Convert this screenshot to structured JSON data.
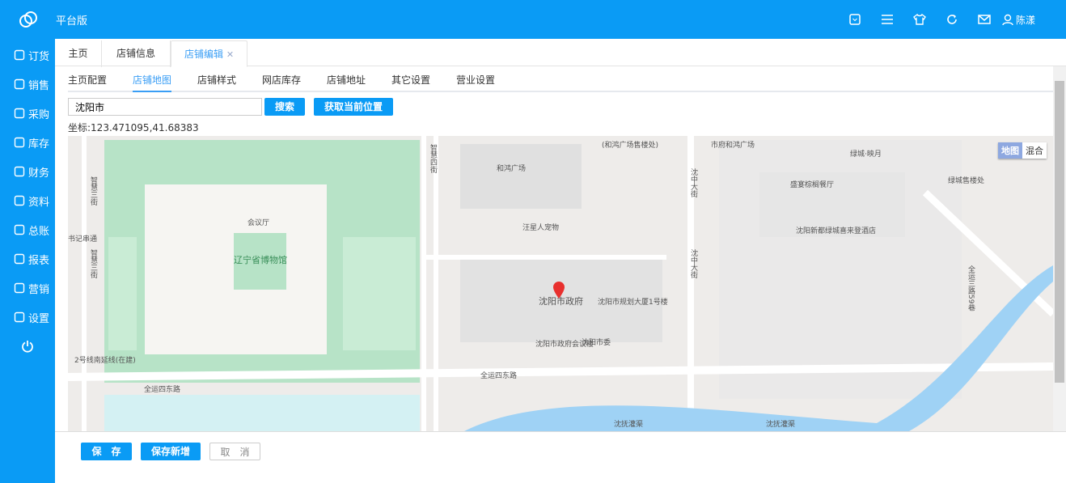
{
  "header": {
    "brand": "平台版",
    "user": "陈漾",
    "icons": [
      "dropdown-box-icon",
      "menu-icon",
      "shirt-icon",
      "refresh-icon",
      "mail-icon",
      "user-icon"
    ]
  },
  "sidebar": {
    "items": [
      {
        "label": "订货",
        "icon": "clipboard-icon"
      },
      {
        "label": "销售",
        "icon": "user-icon"
      },
      {
        "label": "采购",
        "icon": "cart-icon"
      },
      {
        "label": "库存",
        "icon": "box-icon"
      },
      {
        "label": "财务",
        "icon": "wallet-icon"
      },
      {
        "label": "资料",
        "icon": "contacts-icon"
      },
      {
        "label": "总账",
        "icon": "chart-icon"
      },
      {
        "label": "报表",
        "icon": "report-icon"
      },
      {
        "label": "营销",
        "icon": "monitor-icon"
      },
      {
        "label": "设置",
        "icon": "gear-icon"
      }
    ]
  },
  "tabs": [
    {
      "label": "主页"
    },
    {
      "label": "店铺信息"
    },
    {
      "label": "店铺编辑",
      "active": true
    }
  ],
  "subtabs": [
    {
      "label": "主页配置"
    },
    {
      "label": "店铺地图",
      "active": true
    },
    {
      "label": "店铺样式"
    },
    {
      "label": "网店库存"
    },
    {
      "label": "店铺地址"
    },
    {
      "label": "其它设置"
    },
    {
      "label": "营业设置"
    }
  ],
  "search": {
    "value": "沈阳市",
    "button": "搜索",
    "locate_button": "获取当前位置"
  },
  "coordinate": "坐标:123.471095,41.68383",
  "map": {
    "type_toggle": [
      "地图",
      "混合"
    ],
    "labels": [
      "辽宁省博物馆",
      "会议厅",
      "和鸿广场",
      "汪星人宠物",
      "沈阳市政府",
      "沈阳市政府会议楼",
      "沈阳市委",
      "沈阳市规划大厦1号楼",
      "全运四东路",
      "全运四东路",
      "沈抚灌渠",
      "沈抚灌渠",
      "盛宴棕榈餐厅",
      "沈阳新都绿城喜来登酒店",
      "绿城售楼处",
      "绿城·映月",
      "市府和鸿广场",
      "全运三路59巷",
      "智慧四街",
      "智慧三街",
      "智慧三街",
      "沈中大街",
      "沈中大街",
      "2号线南延线(在建)",
      "书记串通",
      "(和鸿广场售楼处)"
    ]
  },
  "footer": {
    "save": "保　存",
    "save_new": "保存新增",
    "cancel": "取　消"
  }
}
